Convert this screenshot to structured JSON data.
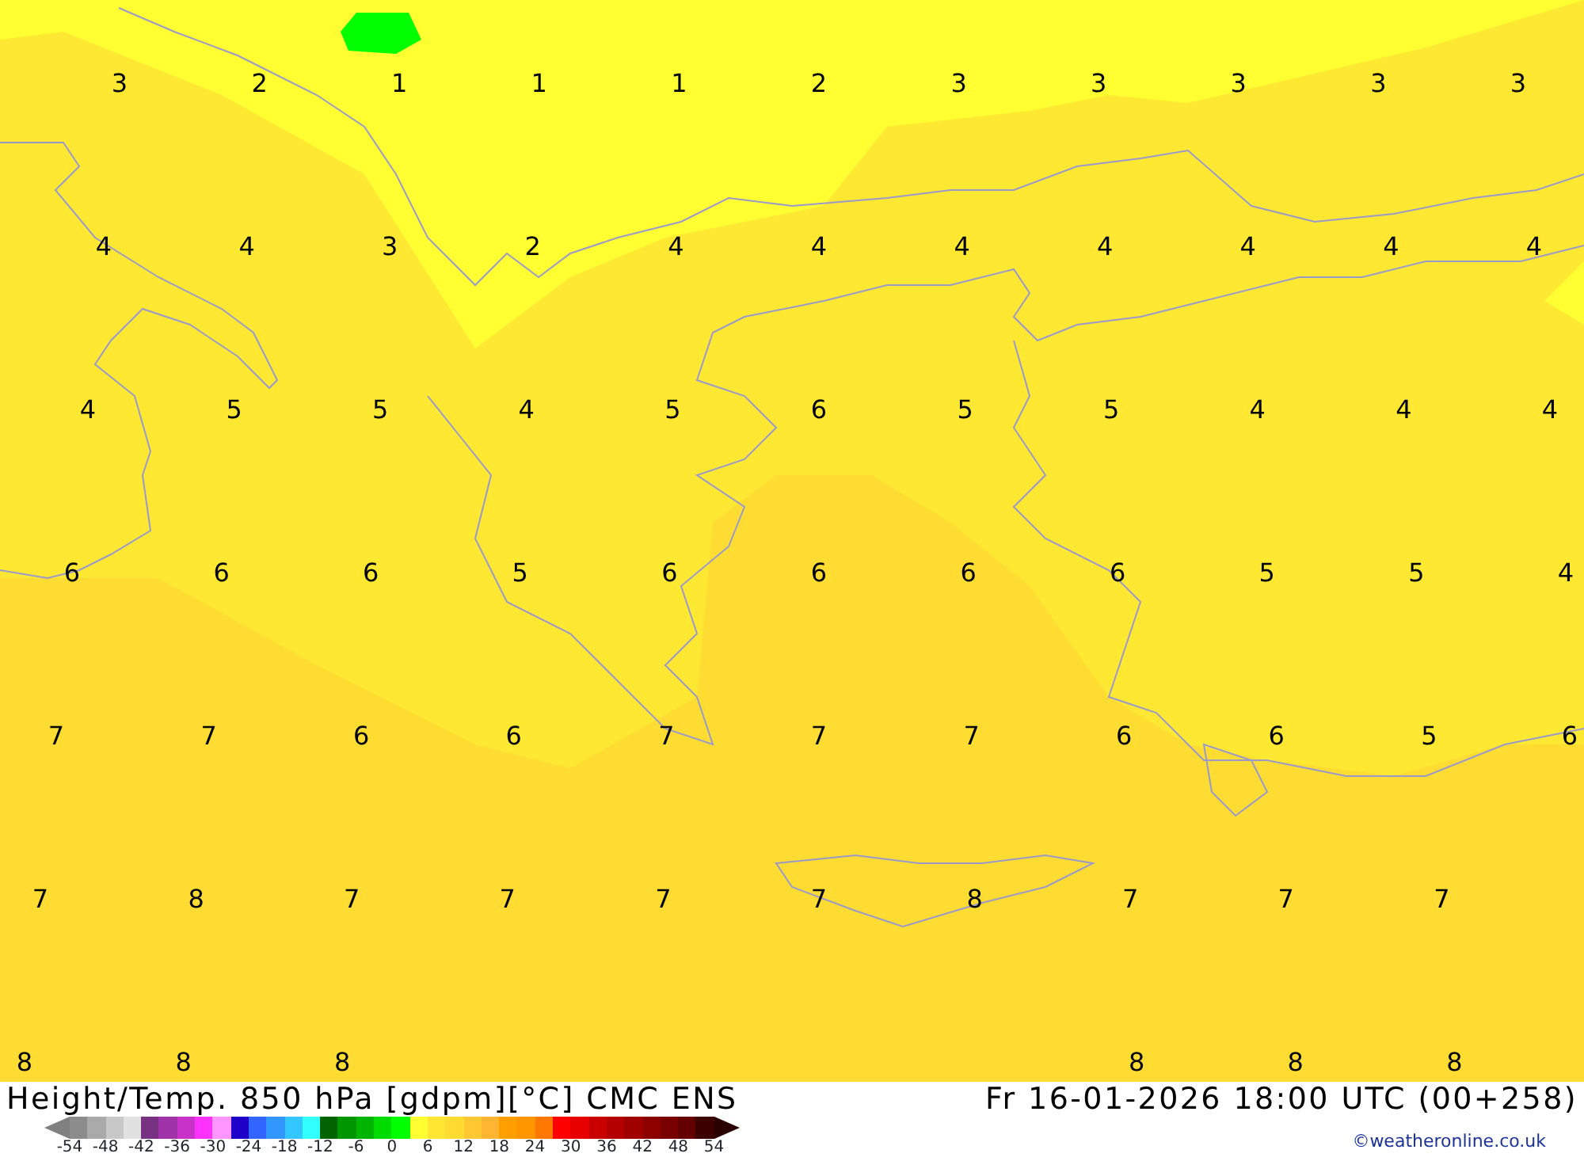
{
  "map": {
    "contour_labels": [
      [
        "3",
        "2",
        "1",
        "1",
        "1",
        "2",
        "3",
        "3",
        "3",
        "3",
        "3"
      ],
      [
        "4",
        "4",
        "3",
        "2",
        "4",
        "4",
        "4",
        "4",
        "4",
        "4",
        "4"
      ],
      [
        "4",
        "5",
        "5",
        "4",
        "5",
        "6",
        "5",
        "5",
        "4",
        "4",
        "4"
      ],
      [
        "6",
        "6",
        "6",
        "5",
        "6",
        "6",
        "6",
        "6",
        "5",
        "5",
        "4"
      ],
      [
        "7",
        "7",
        "6",
        "6",
        "7",
        "7",
        "7",
        "6",
        "6",
        "5",
        "6"
      ],
      [
        "7",
        "8",
        "7",
        "7",
        "7",
        "7",
        "8",
        "7",
        "7",
        "7"
      ],
      [
        "8",
        "8",
        "8"
      ]
    ],
    "bottom_right_labels": [
      "8",
      "8",
      "8"
    ]
  },
  "footer": {
    "title": "Height/Temp. 850 hPa [gdpm][°C] CMC ENS",
    "valid_time": "Fr 16-01-2026 18:00 UTC (00+258)",
    "credit": "©weatheronline.co.uk",
    "legend": {
      "swatches": [
        {
          "kind": "low",
          "color": "#808080"
        },
        {
          "kind": "step",
          "color": "#8c8c8c"
        },
        {
          "kind": "step",
          "color": "#aaaaaa"
        },
        {
          "kind": "step",
          "color": "#c8c8c8"
        },
        {
          "kind": "step",
          "color": "#e1e1e1"
        },
        {
          "kind": "step",
          "color": "#783282"
        },
        {
          "kind": "step",
          "color": "#a032aa"
        },
        {
          "kind": "step",
          "color": "#c832c8"
        },
        {
          "kind": "step",
          "color": "#fa32fa"
        },
        {
          "kind": "step",
          "color": "#ff96ff"
        },
        {
          "kind": "step",
          "color": "#1e00c8"
        },
        {
          "kind": "step",
          "color": "#3264ff"
        },
        {
          "kind": "step",
          "color": "#3296ff"
        },
        {
          "kind": "step",
          "color": "#32c8ff"
        },
        {
          "kind": "step",
          "color": "#32ffff"
        },
        {
          "kind": "step",
          "color": "#006400"
        },
        {
          "kind": "step",
          "color": "#009600"
        },
        {
          "kind": "step",
          "color": "#00b400"
        },
        {
          "kind": "step",
          "color": "#00dc00"
        },
        {
          "kind": "step",
          "color": "#00ff00"
        },
        {
          "kind": "step",
          "color": "#ffff32"
        },
        {
          "kind": "step",
          "color": "#ffe632"
        },
        {
          "kind": "step",
          "color": "#ffdc32"
        },
        {
          "kind": "step",
          "color": "#ffc832"
        },
        {
          "kind": "step",
          "color": "#ffb432"
        },
        {
          "kind": "step",
          "color": "#ffa000"
        },
        {
          "kind": "step",
          "color": "#ff9600"
        },
        {
          "kind": "step",
          "color": "#ff7800"
        },
        {
          "kind": "step",
          "color": "#ff0000"
        },
        {
          "kind": "step",
          "color": "#e60000"
        },
        {
          "kind": "step",
          "color": "#c80000"
        },
        {
          "kind": "step",
          "color": "#b40000"
        },
        {
          "kind": "step",
          "color": "#a00000"
        },
        {
          "kind": "step",
          "color": "#8c0000"
        },
        {
          "kind": "step",
          "color": "#780000"
        },
        {
          "kind": "step",
          "color": "#640000"
        },
        {
          "kind": "step",
          "color": "#3c0000"
        },
        {
          "kind": "high",
          "color": "#280000"
        }
      ],
      "ticks": [
        "-54",
        "-48",
        "-42",
        "-36",
        "-30",
        "-24",
        "-18",
        "-12",
        "-6",
        "0",
        "6",
        "12",
        "18",
        "24",
        "30",
        "36",
        "42",
        "48",
        "54"
      ]
    }
  }
}
